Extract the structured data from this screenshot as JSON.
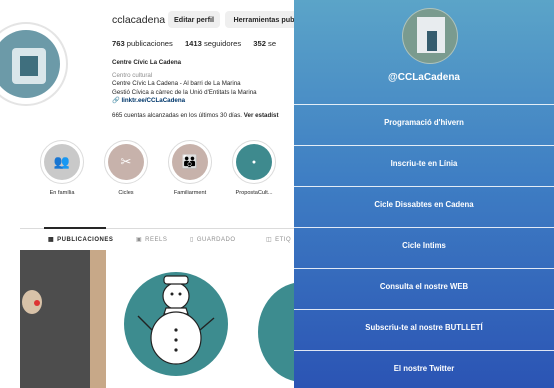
{
  "instagram": {
    "username": "cclacadena",
    "edit_profile": "Editar perfil",
    "tools": "Herramientas publ",
    "stats": [
      {
        "value": "763",
        "label": "publicaciones"
      },
      {
        "value": "1413",
        "label": "seguidores"
      },
      {
        "value": "352",
        "label": "se"
      }
    ],
    "bio": {
      "name": "Centre Cívic La Cadena",
      "category": "Centro cultural",
      "line1": "Centre Cívic La Cadena - Al barri de La Marina",
      "line2": "Gestió Cívica a càrrec de la Unió d'Entitats la Marina",
      "link": "linktr.ee/CCLaCadena",
      "reach_text": "665 cuentas alcanzadas en los últimos 30 días.",
      "reach_link": "Ver estadíst"
    },
    "highlights": [
      {
        "label": "En família",
        "icon": "people-icon",
        "color": "#c9c9c9"
      },
      {
        "label": "Cicles",
        "icon": "ribbon-icon",
        "color": "#c7b2ab"
      },
      {
        "label": "Familiarment",
        "icon": "family-icon",
        "color": "#c7b2ab"
      },
      {
        "label": "PropostaCult...",
        "icon": "logo-icon",
        "color": "#3e8a8e"
      }
    ],
    "tabs": [
      {
        "label": "PUBLICACIONES",
        "icon": "grid-icon",
        "active": true
      },
      {
        "label": "REELS",
        "icon": "reels-icon",
        "active": false
      },
      {
        "label": "GUARDADO",
        "icon": "bookmark-icon",
        "active": false
      },
      {
        "label": "ETIQ",
        "icon": "tag-icon",
        "active": false
      }
    ]
  },
  "linktree": {
    "handle": "@CCLaCadena",
    "links": [
      "Programació d'hivern",
      "Inscriu-te en Línia",
      "Cicle Dissabtes en Cadena",
      "Cicle Intims",
      "Consulta el nostre WEB",
      "Subscriu-te al nostre BUTLLETÍ",
      "El nostre Twitter"
    ]
  }
}
